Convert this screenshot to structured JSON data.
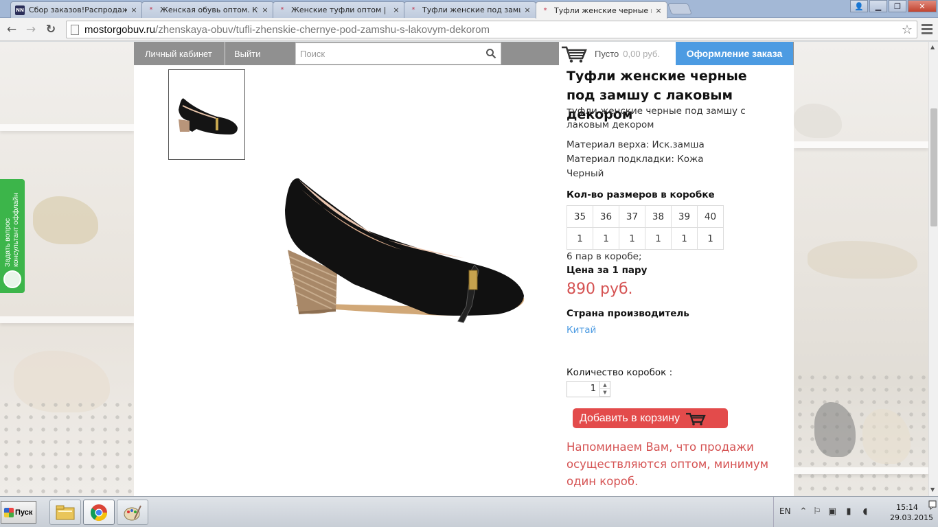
{
  "browser": {
    "tabs": [
      {
        "label": "Сбор заказов!Распродажа до",
        "favicon": "NN"
      },
      {
        "label": "Женская обувь оптом. Купить",
        "favicon": "*"
      },
      {
        "label": "Женские туфли оптом | Веб-",
        "favicon": "*"
      },
      {
        "label": "Туфли женские под замшу с",
        "favicon": "*"
      },
      {
        "label": "Туфли женские черные под",
        "favicon": "*"
      }
    ],
    "close_glyph": "×",
    "url_host": "mostorgobuv.ru",
    "url_path": "/zhenskaya-obuv/tufli-zhenskie-chernye-pod-zamshu-s-lakovym-dekorom",
    "back_glyph": "←",
    "forward_glyph": "→",
    "reload_glyph": "↻",
    "star_glyph": "☆",
    "win_min": "▁",
    "win_restore": "❐",
    "win_close": "✕",
    "win_user": "👤"
  },
  "site": {
    "nav": {
      "account": "Личный кабинет",
      "logout": "Выйти"
    },
    "search_placeholder": "Поиск",
    "cart": {
      "empty": "Пусто",
      "sum": "0,00 руб."
    },
    "checkout": "Оформление заказа"
  },
  "widget": {
    "line1": "Задать вопрос",
    "line2": "консультант оффлайн"
  },
  "product": {
    "title": "Туфли женские черные под замшу с лаковым декором",
    "subtitle": "туфли женские черные под замшу с лаковым декором",
    "material_upper": "Материал верха: Иск.замша",
    "material_lining": "Материал подкладки: Кожа",
    "color": "Черный",
    "sizes_heading": "Кол-во размеров в коробке",
    "sizes": [
      "35",
      "36",
      "37",
      "38",
      "39",
      "40"
    ],
    "counts": [
      "1",
      "1",
      "1",
      "1",
      "1",
      "1"
    ],
    "pairs_in_box": "6 пар в коробе;",
    "price_label": "Цена за 1 пару",
    "price": "890 руб.",
    "country_label": "Страна производитель",
    "country": "Китай",
    "qty_label": "Количество коробок :",
    "qty_value": "1",
    "add_to_cart": "Добавить в корзину",
    "notice": "Напоминаем Вам, что продажи осуществляются оптом, минимум один короб."
  },
  "taskbar": {
    "start": "Пуск",
    "lang": "EN",
    "time": "15:14",
    "date": "29.03.2015"
  },
  "colors": {
    "accent_blue": "#4c9be2",
    "price_red": "#d55252",
    "button_red": "#e34b4b",
    "widget_green": "#3cb54a"
  }
}
